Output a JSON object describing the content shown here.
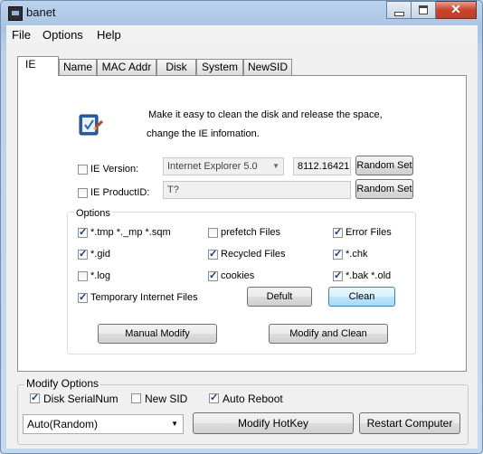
{
  "window": {
    "title": "banet"
  },
  "menu": [
    "File",
    "Options",
    "Help"
  ],
  "tabs": [
    "IE",
    "Name",
    "MAC Addr",
    "Disk",
    "System",
    "NewSID"
  ],
  "ie_tab": {
    "description_line1": "Make it easy to clean the disk and release the space,",
    "description_line2": "change the IE infomation.",
    "ie_version": {
      "label": "IE Version:",
      "checked": false,
      "value": "Internet Explorer 5.0",
      "build": "8112.16421",
      "button": "Random Set"
    },
    "ie_product": {
      "label": "IE ProductID:",
      "checked": false,
      "value": "T?",
      "button": "Random Set"
    },
    "options_title": "Options",
    "options": [
      {
        "label": "*.tmp  *._mp  *.sqm",
        "checked": true
      },
      {
        "label": "prefetch Files",
        "checked": false
      },
      {
        "label": "Error Files",
        "checked": true
      },
      {
        "label": "*.gid",
        "checked": true
      },
      {
        "label": "Recycled Files",
        "checked": true
      },
      {
        "label": "*.chk",
        "checked": true
      },
      {
        "label": "*.log",
        "checked": false
      },
      {
        "label": "cookies",
        "checked": true
      },
      {
        "label": "*.bak  *.old",
        "checked": true
      },
      {
        "label": "Temporary Internet Files",
        "checked": true
      }
    ],
    "default_button": "Defult",
    "clean_button": "Clean",
    "manual_modify_button": "Manual Modify",
    "modify_and_clean_button": "Modify and Clean"
  },
  "modify_options": {
    "title": "Modify Options",
    "disk_serial": {
      "label": "Disk SerialNum",
      "checked": true
    },
    "new_sid": {
      "label": "New SID",
      "checked": false
    },
    "auto_reboot": {
      "label": "Auto Reboot",
      "checked": true
    },
    "mode_select": "Auto(Random)",
    "hotkey_button": "Modify HotKey",
    "restart_button": "Restart Computer"
  },
  "colors": {
    "focus_button": "#bee6fd",
    "check_mark": "#1b3d7a",
    "close_button": "#c8442e"
  }
}
